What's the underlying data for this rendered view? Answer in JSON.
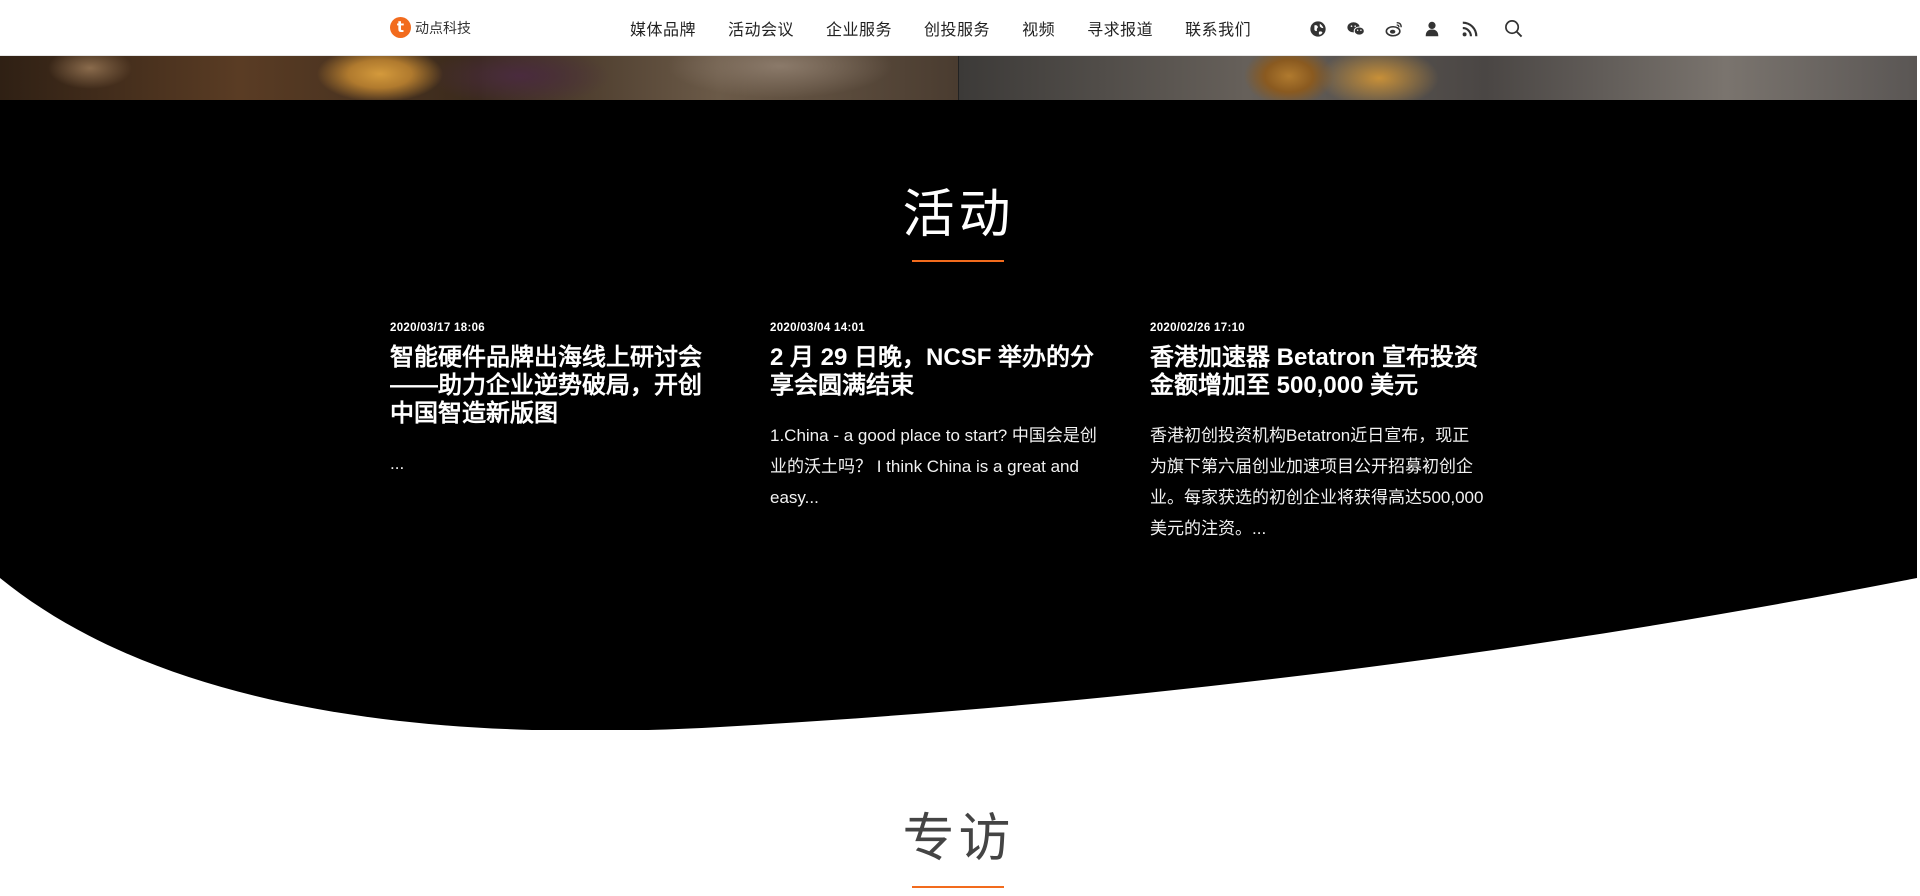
{
  "header": {
    "logo_mark": "t",
    "logo_text": "动点科技",
    "nav": [
      "媒体品牌",
      "活动会议",
      "企业服务",
      "创投服务",
      "视频",
      "寻求报道",
      "联系我们"
    ],
    "icons": [
      "globe-icon",
      "wechat-icon",
      "weibo-icon",
      "user-icon",
      "rss-icon",
      "search-icon"
    ]
  },
  "events": {
    "title": "活动",
    "items": [
      {
        "date": "2020/03/17 18:06",
        "title": "智能硬件品牌出海线上研讨会——助力企业逆势破局，开创中国智造新版图",
        "excerpt": "..."
      },
      {
        "date": "2020/03/04 14:01",
        "title": "2 月 29 日晚，NCSF 举办的分享会圆满结束",
        "excerpt": "1.China - a good place to start? 中国会是创业的沃土吗？ I think China is a great and easy..."
      },
      {
        "date": "2020/02/26 17:10",
        "title": "香港加速器 Betatron 宣布投资金额增加至 500,000 美元",
        "excerpt": "香港初创投资机构Betatron近日宣布，现正为旗下第六届创业加速项目公开招募初创企业。每家获选的初创企业将获得高达500,000美元的注资。..."
      }
    ]
  },
  "interviews": {
    "title": "专访"
  },
  "colors": {
    "accent": "#f26b1d",
    "events_bg": "#000000",
    "page_bg": "#ffffff"
  }
}
